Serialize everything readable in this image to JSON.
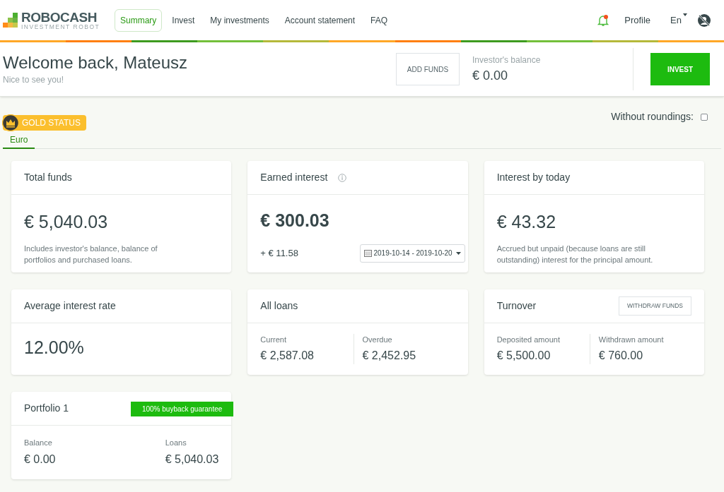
{
  "logo": {
    "name": "ROBOCASH",
    "tagline": "INVESTMENT ROBOT"
  },
  "nav": [
    {
      "label": "Summary",
      "selected": true
    },
    {
      "label": "Invest",
      "selected": false
    },
    {
      "label": "My investments",
      "selected": false
    },
    {
      "label": "Account statement",
      "selected": false
    },
    {
      "label": "FAQ",
      "selected": false
    }
  ],
  "user_menu": {
    "notification": true,
    "profile": "Profile",
    "language": "En"
  },
  "welcome": {
    "title": "Welcome back, Mateusz",
    "subtitle": "Nice to see you!",
    "add_funds": "ADD FUNDS",
    "balance_label": "Investor's balance",
    "balance": "€ 0.00",
    "invest": "INVEST"
  },
  "status_badge": "GOLD STATUS",
  "without_roundings": {
    "label": "Without roundings:",
    "checked": false
  },
  "currency_tabs": [
    {
      "label": "Euro",
      "selected": true
    }
  ],
  "cards": [
    {
      "kind": "amount",
      "title": "Total funds",
      "value": "€ 5,040.03",
      "note": "Includes investor's balance, balance of portfolios and purchased loans."
    },
    {
      "kind": "earned",
      "title": "Earned interest",
      "info": true,
      "value": "€ 300.03",
      "change": "+ € 11.58",
      "date_range": "2019-10-14 - 2019-10-20"
    },
    {
      "kind": "amount",
      "title": "Interest by today",
      "value": "€ 43.32",
      "note": "Accrued but unpaid (because loans are still outstanding) interest for the principal amount."
    },
    {
      "kind": "rate",
      "title": "Average interest rate",
      "value": "12.00%"
    },
    {
      "kind": "split",
      "title": "All loans",
      "items": [
        {
          "label": "Current",
          "value": "€ 2,587.08"
        },
        {
          "label": "Overdue",
          "value": "€ 2,452.95"
        }
      ]
    },
    {
      "kind": "split",
      "title": "Turnover",
      "button": "WITHDRAW FUNDS",
      "items": [
        {
          "label": "Deposited amount",
          "value": "€ 5,500.00"
        },
        {
          "label": "Withdrawn amount",
          "value": "€ 760.00"
        }
      ]
    },
    {
      "kind": "split",
      "title": "Portfolio 1",
      "badge": "100% buyback guarantee",
      "items": [
        {
          "label": "Balance",
          "value": "€ 0.00"
        },
        {
          "label": "Loans",
          "value": "€ 5,040.03"
        }
      ]
    }
  ]
}
